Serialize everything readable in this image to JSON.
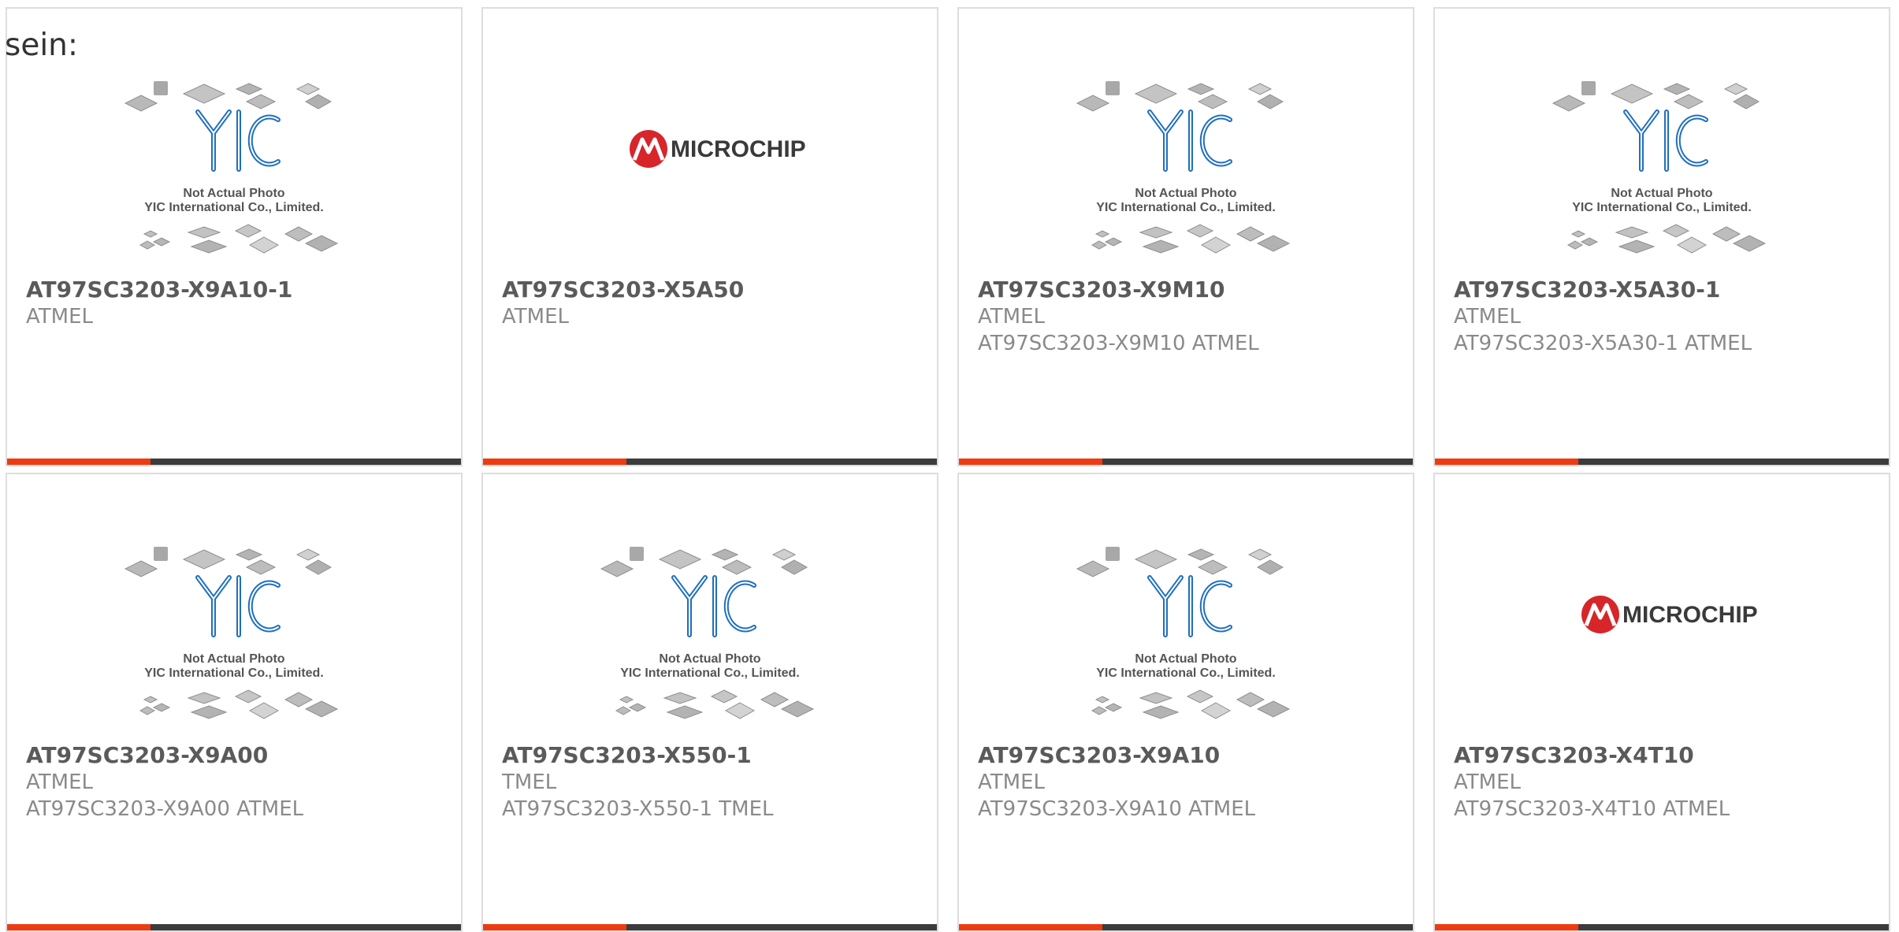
{
  "lead_text": "sein:",
  "placeholder_caption": {
    "line1": "Not Actual Photo",
    "line2": "YIC International Co., Limited."
  },
  "logo_text": "MICROCHIP",
  "colors": {
    "accent": "#ee3b12",
    "bar": "#3c3c3c",
    "yic_blue": "#1f6fbf",
    "microchip_red": "#d6262a"
  },
  "products": [
    {
      "name": "AT97SC3203-X9A10-1",
      "brand": "ATMEL",
      "desc": "",
      "image": "yic-placeholder"
    },
    {
      "name": "AT97SC3203-X5A50",
      "brand": "ATMEL",
      "desc": "",
      "image": "microchip-logo"
    },
    {
      "name": "AT97SC3203-X9M10",
      "brand": "ATMEL",
      "desc": "AT97SC3203-X9M10 ATMEL",
      "image": "yic-placeholder"
    },
    {
      "name": "AT97SC3203-X5A30-1",
      "brand": "ATMEL",
      "desc": "AT97SC3203-X5A30-1 ATMEL",
      "image": "yic-placeholder"
    },
    {
      "name": "AT97SC3203-X9A00",
      "brand": "ATMEL",
      "desc": "AT97SC3203-X9A00 ATMEL",
      "image": "yic-placeholder"
    },
    {
      "name": "AT97SC3203-X550-1",
      "brand": "TMEL",
      "desc": "AT97SC3203-X550-1 TMEL",
      "image": "yic-placeholder"
    },
    {
      "name": "AT97SC3203-X9A10",
      "brand": "ATMEL",
      "desc": "AT97SC3203-X9A10 ATMEL",
      "image": "yic-placeholder"
    },
    {
      "name": "AT97SC3203-X4T10",
      "brand": "ATMEL",
      "desc": "AT97SC3203-X4T10 ATMEL",
      "image": "microchip-logo"
    }
  ]
}
